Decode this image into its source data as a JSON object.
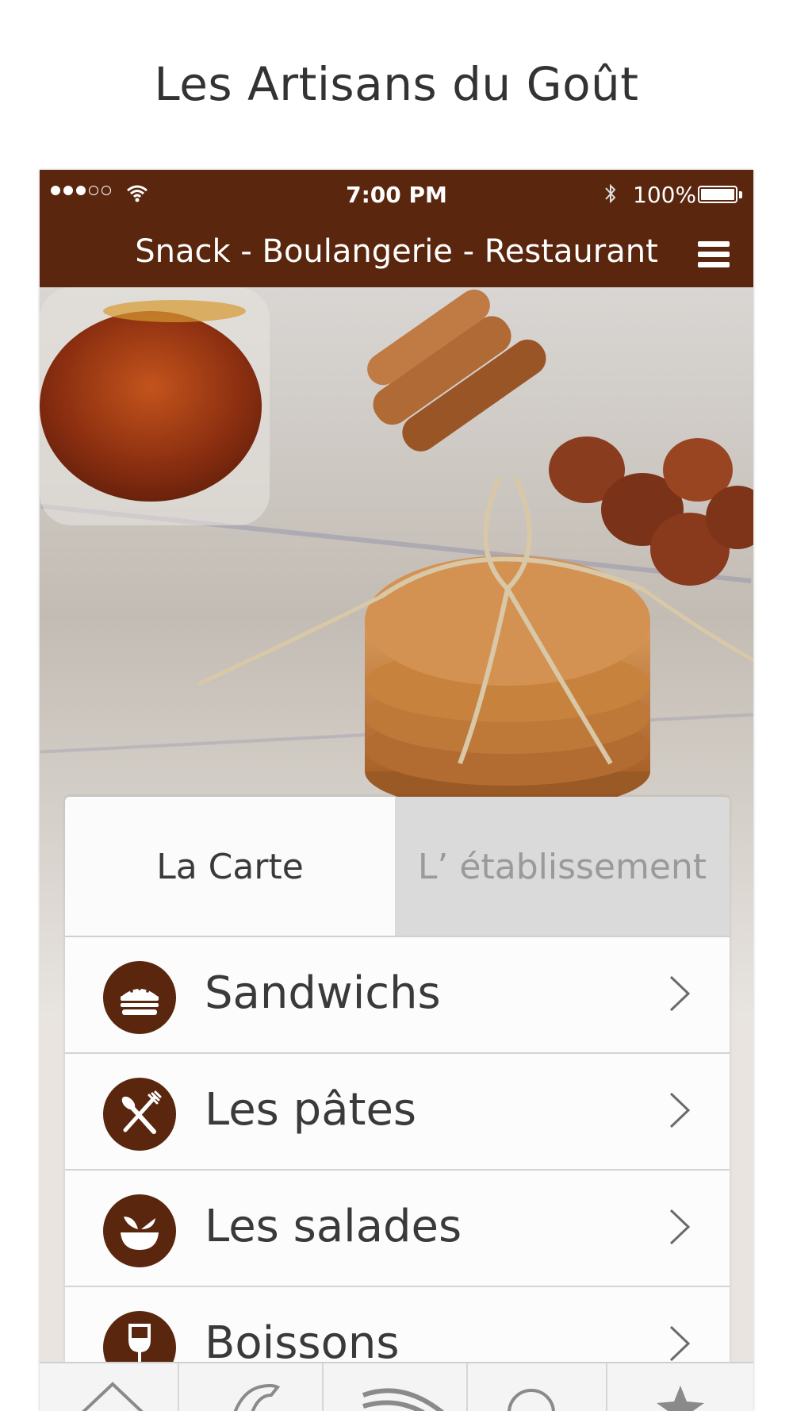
{
  "page": {
    "title": "Les Artisans du Goût"
  },
  "status_bar": {
    "time": "7:00 PM",
    "battery": "100%"
  },
  "nav": {
    "title": "Snack - Boulangerie - Restaurant"
  },
  "tabs": [
    {
      "label": "La Carte",
      "active": true
    },
    {
      "label": "L’ établissement",
      "active": false
    }
  ],
  "menu": [
    {
      "label": "Sandwichs",
      "icon": "sandwich-icon"
    },
    {
      "label": "Les pâtes",
      "icon": "fork-knife-icon"
    },
    {
      "label": "Les salades",
      "icon": "salad-bowl-icon"
    },
    {
      "label": "Boissons",
      "icon": "wine-glass-icon"
    }
  ],
  "tabbar": [
    {
      "icon": "home-icon"
    },
    {
      "icon": "phone-icon"
    },
    {
      "icon": "rss-icon"
    },
    {
      "icon": "search-icon"
    },
    {
      "icon": "star-icon"
    }
  ],
  "colors": {
    "brand": "#5a260e",
    "inactive_tab": "#dadada"
  }
}
